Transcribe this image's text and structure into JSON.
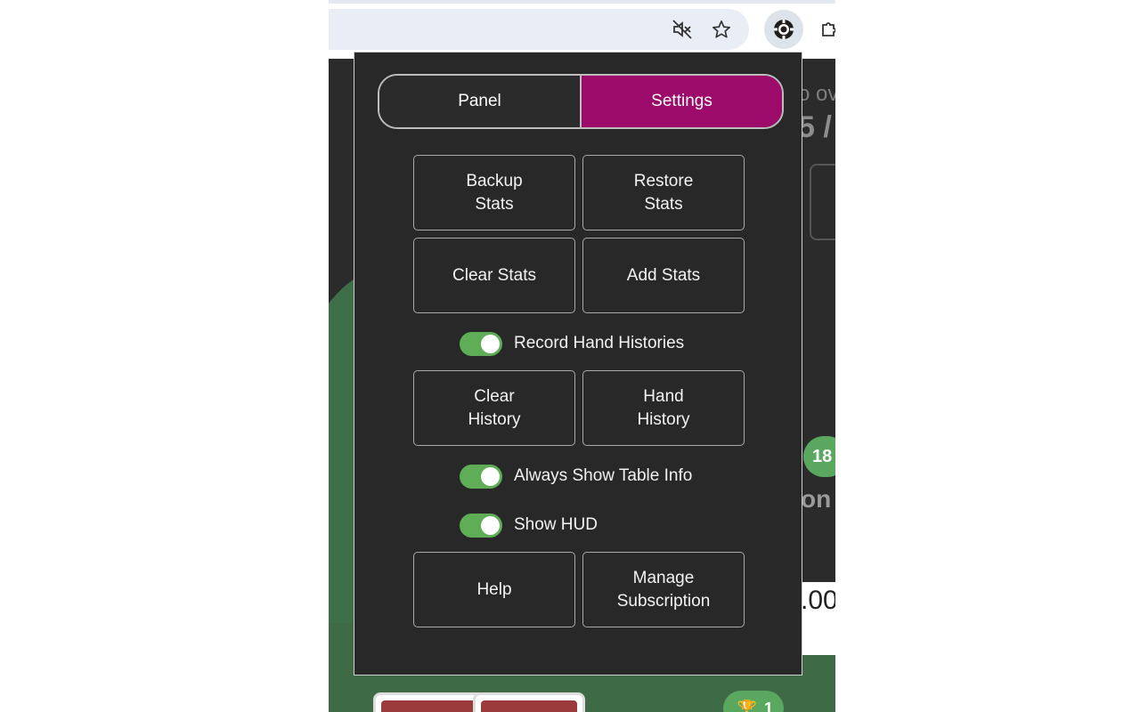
{
  "background": {
    "partial_text_1": "o ov",
    "partial_text_2": "5 /",
    "partial_text_3": "on",
    "partial_text_4": ".00",
    "badge_1": "18",
    "badge_2": "1"
  },
  "popup": {
    "tabs": [
      {
        "label": "Panel",
        "active": false
      },
      {
        "label": "Settings",
        "active": true
      }
    ],
    "buttons": {
      "backup_stats": "Backup\nStats",
      "restore_stats": "Restore\nStats",
      "clear_stats": "Clear Stats",
      "add_stats": "Add Stats",
      "clear_history": "Clear\nHistory",
      "hand_history": "Hand\nHistory",
      "help": "Help",
      "manage_subscription": "Manage\nSubscription"
    },
    "toggles": {
      "record_hand_histories": {
        "label": "Record Hand Histories",
        "on": true
      },
      "always_show_table_info": {
        "label": "Always Show Table Info",
        "on": true
      },
      "show_hud": {
        "label": "Show HUD",
        "on": true
      }
    }
  },
  "toolbar_icons": [
    "mute-icon",
    "star-icon",
    "poker-chip-extension-icon",
    "puzzle-icon"
  ],
  "colors": {
    "accent": "#9c0a6a",
    "toggle_on": "#5fae57",
    "panel_bg": "#282828"
  }
}
